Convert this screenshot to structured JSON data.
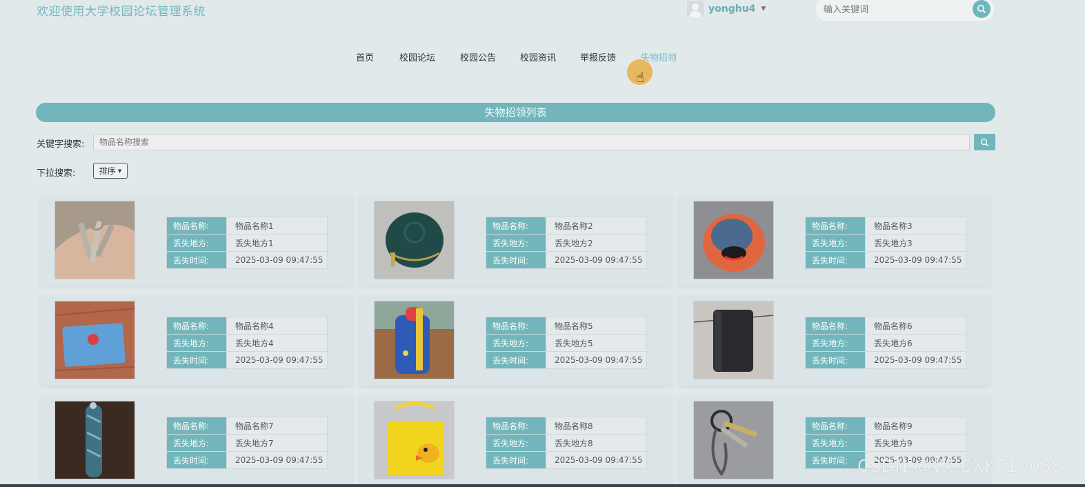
{
  "header": {
    "site_title": "欢迎使用大学校园论坛管理系统",
    "user_name": "yonghu4",
    "search_placeholder": "输入关键词"
  },
  "nav": {
    "items": [
      "首页",
      "校园论坛",
      "校园公告",
      "校园资讯",
      "举报反馈",
      "失物招领"
    ],
    "active": "失物招领"
  },
  "page": {
    "list_title": "失物招领列表",
    "keyword_label": "关键字搜索:",
    "keyword_placeholder": "物品名称搜索",
    "dropdown_label": "下拉搜索:",
    "sort_label": "排序"
  },
  "field_labels": {
    "name": "物品名称:",
    "place": "丢失地方:",
    "time": "丢失时间:"
  },
  "items": [
    {
      "name": "物品名称1",
      "place": "丢失地方1",
      "time": "2025-03-09 09:47:55",
      "photo": "keys-in-hand"
    },
    {
      "name": "物品名称2",
      "place": "丢失地方2",
      "time": "2025-03-09 09:47:55",
      "photo": "green-coin-purse"
    },
    {
      "name": "物品名称3",
      "place": "丢失地方3",
      "time": "2025-03-09 09:47:55",
      "photo": "orange-cap"
    },
    {
      "name": "物品名称4",
      "place": "丢失地方4",
      "time": "2025-03-09 09:47:55",
      "photo": "blue-id-card"
    },
    {
      "name": "物品名称5",
      "place": "丢失地方5",
      "time": "2025-03-09 09:47:55",
      "photo": "kids-water-bottle"
    },
    {
      "name": "物品名称6",
      "place": "丢失地方6",
      "time": "2025-03-09 09:47:55",
      "photo": "black-wallet"
    },
    {
      "name": "物品名称7",
      "place": "丢失地方7",
      "time": "2025-03-09 09:47:55",
      "photo": "folded-umbrella"
    },
    {
      "name": "物品名称8",
      "place": "丢失地方8",
      "time": "2025-03-09 09:47:55",
      "photo": "yellow-duck-bag"
    },
    {
      "name": "物品名称9",
      "place": "丢失地方9",
      "time": "2025-03-09 09:47:55",
      "photo": "keychain"
    }
  ],
  "watermark": "CSDN @Vx  CXKF10088",
  "colors": {
    "accent": "#72b6bb",
    "background": "#e1e9eb",
    "nav_active": "#7dbec4",
    "cursor_highlight": "#e8b34f"
  }
}
